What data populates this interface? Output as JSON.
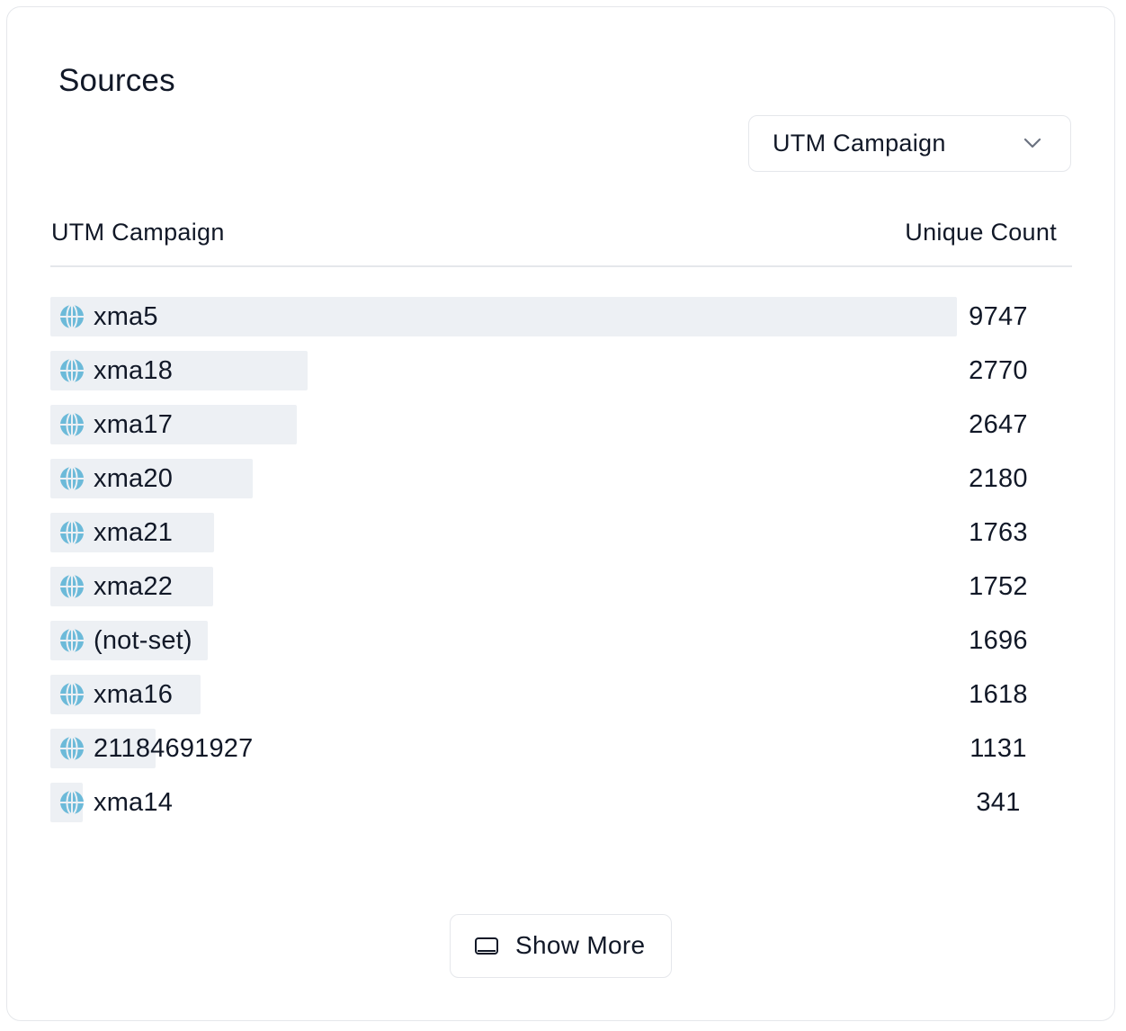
{
  "card": {
    "title": "Sources",
    "dropdown": {
      "selected": "UTM Campaign",
      "icon": "chevron-down-icon"
    },
    "table": {
      "columns": [
        "UTM Campaign",
        "Unique Count"
      ],
      "row_icon": "globe-icon",
      "rows": [
        {
          "name": "xma5",
          "count": 9747
        },
        {
          "name": "xma18",
          "count": 2770
        },
        {
          "name": "xma17",
          "count": 2647
        },
        {
          "name": "xma20",
          "count": 2180
        },
        {
          "name": "xma21",
          "count": 1763
        },
        {
          "name": "xma22",
          "count": 1752
        },
        {
          "name": "(not-set)",
          "count": 1696
        },
        {
          "name": "xma16",
          "count": 1618
        },
        {
          "name": "21184691927",
          "count": 1131
        },
        {
          "name": "xma14",
          "count": 341
        }
      ]
    },
    "show_more": {
      "label": "Show More",
      "icon": "panel-icon"
    }
  },
  "colors": {
    "bar": "#edf0f4",
    "globe": "#6cbad9",
    "border": "#e5e7eb",
    "text": "#111827"
  }
}
